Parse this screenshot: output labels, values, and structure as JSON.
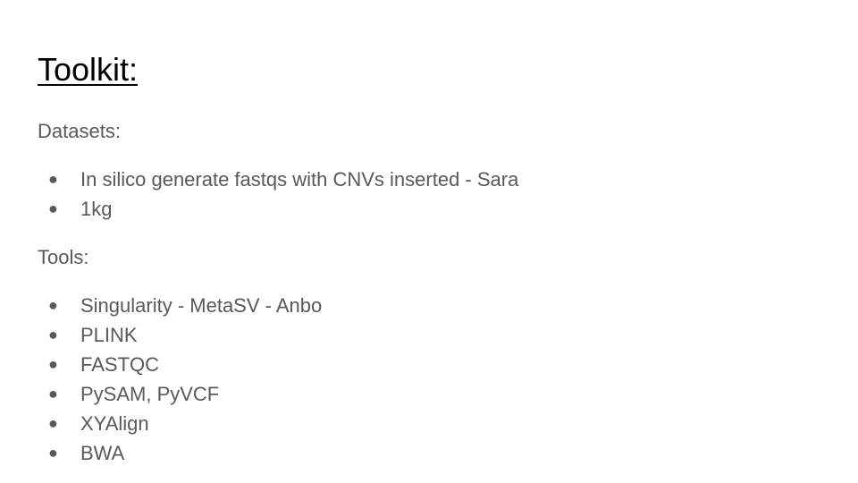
{
  "slide": {
    "title": "Toolkit:",
    "text_color": "#595959",
    "title_color": "#000000",
    "bullet_glyph": "●",
    "datasets": {
      "heading": "Datasets:",
      "items": [
        "In silico generate fastqs with CNVs inserted - Sara",
        "1kg"
      ]
    },
    "tools": {
      "heading": "Tools:",
      "items": [
        "Singularity - MetaSV - Anbo",
        "PLINK",
        "FASTQC",
        "PySAM, PyVCF",
        "XYAlign",
        "BWA"
      ]
    }
  }
}
